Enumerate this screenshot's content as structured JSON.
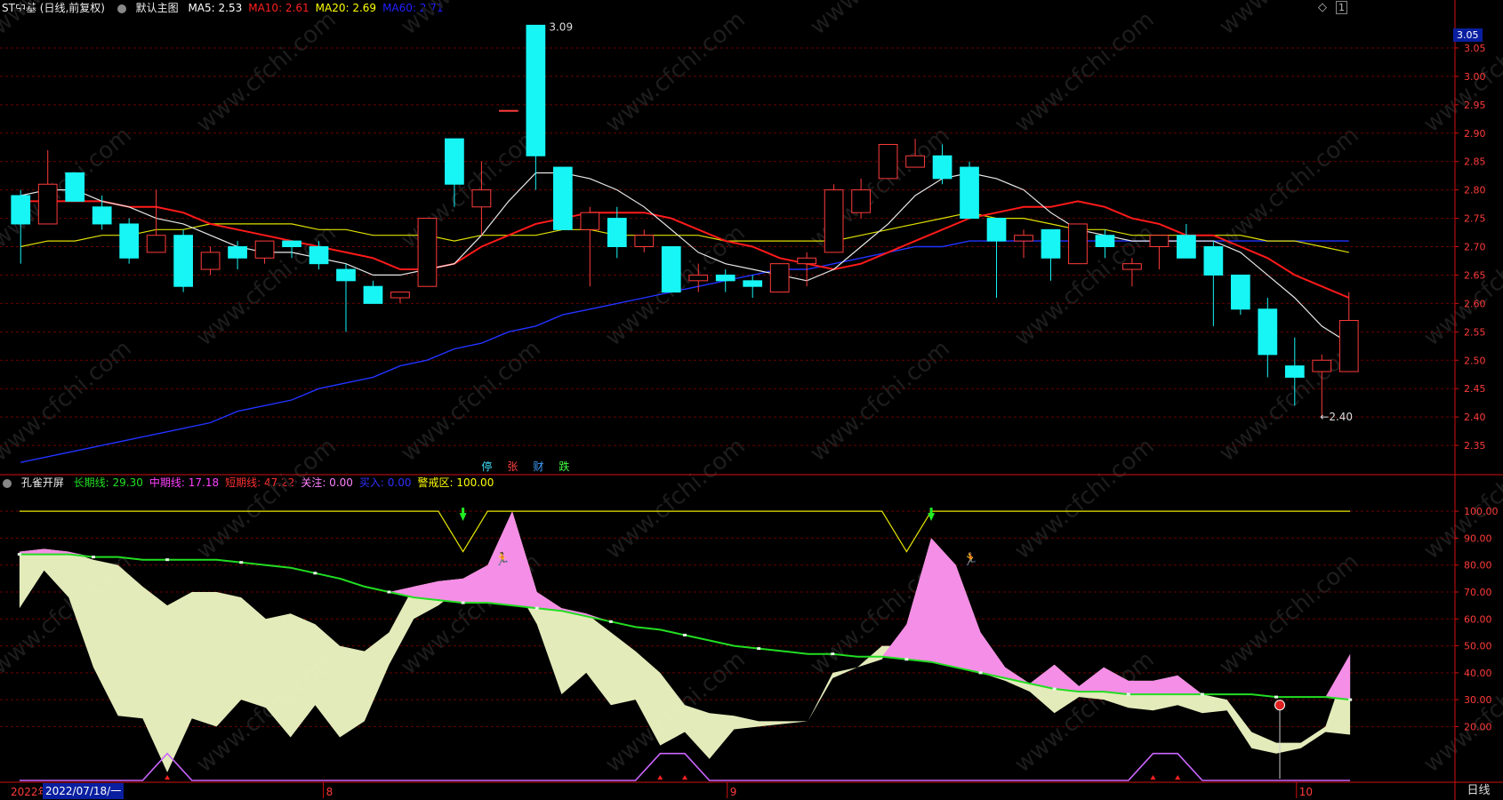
{
  "header": {
    "title": "ST中基 (日线,前复权)",
    "template_label": "默认主图",
    "ma_items": [
      {
        "name": "MA5:",
        "value": "2.53",
        "color": "#ffffff"
      },
      {
        "name": "MA10:",
        "value": "2.61",
        "color": "#ff2020"
      },
      {
        "name": "MA20:",
        "value": "2.69",
        "color": "#ffff00"
      },
      {
        "name": "MA60:",
        "value": "2.71",
        "color": "#2020ff"
      }
    ],
    "diamond_icon": "◇",
    "ctl_1": "1"
  },
  "indicator_header": {
    "name": "孔雀开屏",
    "items": [
      {
        "name": "长期线:",
        "value": "29.30",
        "color": "#22e022"
      },
      {
        "name": "中期线:",
        "value": "17.18",
        "color": "#ff40ff"
      },
      {
        "name": "短期线:",
        "value": "47.22",
        "color": "#ff3030"
      },
      {
        "name": "关注:",
        "value": "0.00",
        "color": "#ff80ff"
      },
      {
        "name": "买入:",
        "value": "0.00",
        "color": "#3030ff"
      },
      {
        "name": "警戒区:",
        "value": "100.00",
        "color": "#ffff00"
      }
    ]
  },
  "signal_labels": [
    {
      "text": "停",
      "color": "#40e0ff"
    },
    {
      "text": "张",
      "color": "#ff4040"
    },
    {
      "text": "财",
      "color": "#40a0ff"
    },
    {
      "text": "跌",
      "color": "#40ff40"
    }
  ],
  "bottom": {
    "year_label": "2022年",
    "date_label": "2022/07/18/一",
    "months": [
      "8",
      "9",
      "10"
    ],
    "period": "日线"
  },
  "price_tag": "3.05",
  "colors": {
    "up": "#ff3b3b",
    "down": "#17f5f5",
    "grid": "#6a0000",
    "axis": "#d01010",
    "watermark": "#1d1d1d"
  },
  "watermark_text": "www.cfchi.com",
  "chart_data": [
    {
      "type": "candlestick",
      "title": "ST中基 (日线,前复权)",
      "ylim": [
        2.3,
        3.1
      ],
      "y_ticks": [
        "3.05",
        "3.00",
        "2.95",
        "2.90",
        "2.85",
        "2.80",
        "2.75",
        "2.70",
        "2.65",
        "2.60",
        "2.55",
        "2.50",
        "2.45",
        "2.40",
        "2.35"
      ],
      "candles": [
        {
          "o": 2.79,
          "h": 2.8,
          "c": 2.74,
          "l": 2.67
        },
        {
          "o": 2.74,
          "h": 2.87,
          "c": 2.81,
          "l": 2.74
        },
        {
          "o": 2.83,
          "h": 2.83,
          "c": 2.78,
          "l": 2.78
        },
        {
          "o": 2.77,
          "h": 2.79,
          "c": 2.74,
          "l": 2.73
        },
        {
          "o": 2.74,
          "h": 2.75,
          "c": 2.68,
          "l": 2.67
        },
        {
          "o": 2.69,
          "h": 2.8,
          "c": 2.72,
          "l": 2.69
        },
        {
          "o": 2.72,
          "h": 2.73,
          "c": 2.63,
          "l": 2.62
        },
        {
          "o": 2.66,
          "h": 2.7,
          "c": 2.69,
          "l": 2.65
        },
        {
          "o": 2.7,
          "h": 2.71,
          "c": 2.68,
          "l": 2.66
        },
        {
          "o": 2.68,
          "h": 2.71,
          "c": 2.71,
          "l": 2.67
        },
        {
          "o": 2.71,
          "h": 2.71,
          "c": 2.7,
          "l": 2.68
        },
        {
          "o": 2.7,
          "h": 2.71,
          "c": 2.67,
          "l": 2.66
        },
        {
          "o": 2.66,
          "h": 2.67,
          "c": 2.64,
          "l": 2.55
        },
        {
          "o": 2.63,
          "h": 2.64,
          "c": 2.6,
          "l": 2.6
        },
        {
          "o": 2.61,
          "h": 2.62,
          "c": 2.62,
          "l": 2.6
        },
        {
          "o": 2.63,
          "h": 2.75,
          "c": 2.75,
          "l": 2.63
        },
        {
          "o": 2.89,
          "h": 2.89,
          "c": 2.81,
          "l": 2.77
        },
        {
          "o": 2.77,
          "h": 2.85,
          "c": 2.8,
          "l": 2.72
        },
        {
          "o": 2.94,
          "h": 2.94,
          "c": 2.94,
          "l": 2.94
        },
        {
          "o": 3.09,
          "h": 3.09,
          "c": 2.86,
          "l": 2.8
        },
        {
          "o": 2.84,
          "h": 2.84,
          "c": 2.73,
          "l": 2.73
        },
        {
          "o": 2.73,
          "h": 2.77,
          "c": 2.76,
          "l": 2.63
        },
        {
          "o": 2.75,
          "h": 2.77,
          "c": 2.7,
          "l": 2.68
        },
        {
          "o": 2.7,
          "h": 2.73,
          "c": 2.72,
          "l": 2.69
        },
        {
          "o": 2.7,
          "h": 2.7,
          "c": 2.62,
          "l": 2.62
        },
        {
          "o": 2.64,
          "h": 2.67,
          "c": 2.65,
          "l": 2.62
        },
        {
          "o": 2.65,
          "h": 2.66,
          "c": 2.64,
          "l": 2.62
        },
        {
          "o": 2.64,
          "h": 2.65,
          "c": 2.63,
          "l": 2.61
        },
        {
          "o": 2.62,
          "h": 2.67,
          "c": 2.67,
          "l": 2.62
        },
        {
          "o": 2.67,
          "h": 2.69,
          "c": 2.68,
          "l": 2.63
        },
        {
          "o": 2.69,
          "h": 2.81,
          "c": 2.8,
          "l": 2.69
        },
        {
          "o": 2.76,
          "h": 2.82,
          "c": 2.8,
          "l": 2.75
        },
        {
          "o": 2.82,
          "h": 2.87,
          "c": 2.88,
          "l": 2.82
        },
        {
          "o": 2.84,
          "h": 2.89,
          "c": 2.86,
          "l": 2.84
        },
        {
          "o": 2.86,
          "h": 2.88,
          "c": 2.82,
          "l": 2.81
        },
        {
          "o": 2.84,
          "h": 2.85,
          "c": 2.75,
          "l": 2.75
        },
        {
          "o": 2.75,
          "h": 2.75,
          "c": 2.71,
          "l": 2.61
        },
        {
          "o": 2.71,
          "h": 2.73,
          "c": 2.72,
          "l": 2.68
        },
        {
          "o": 2.73,
          "h": 2.73,
          "c": 2.68,
          "l": 2.64
        },
        {
          "o": 2.67,
          "h": 2.73,
          "c": 2.74,
          "l": 2.67
        },
        {
          "o": 2.72,
          "h": 2.73,
          "c": 2.7,
          "l": 2.68
        },
        {
          "o": 2.66,
          "h": 2.68,
          "c": 2.67,
          "l": 2.63
        },
        {
          "o": 2.7,
          "h": 2.72,
          "c": 2.72,
          "l": 2.66
        },
        {
          "o": 2.72,
          "h": 2.74,
          "c": 2.68,
          "l": 2.68
        },
        {
          "o": 2.7,
          "h": 2.71,
          "c": 2.65,
          "l": 2.56
        },
        {
          "o": 2.65,
          "h": 2.65,
          "c": 2.59,
          "l": 2.58
        },
        {
          "o": 2.59,
          "h": 2.61,
          "c": 2.51,
          "l": 2.47
        },
        {
          "o": 2.49,
          "h": 2.54,
          "c": 2.47,
          "l": 2.42
        },
        {
          "o": 2.48,
          "h": 2.51,
          "c": 2.5,
          "l": 2.4
        },
        {
          "o": 2.48,
          "h": 2.62,
          "c": 2.57,
          "l": 2.48
        }
      ],
      "ma5": [
        2.79,
        2.8,
        2.8,
        2.78,
        2.77,
        2.75,
        2.74,
        2.72,
        2.7,
        2.69,
        2.69,
        2.68,
        2.67,
        2.65,
        2.65,
        2.66,
        2.67,
        2.72,
        2.78,
        2.83,
        2.83,
        2.82,
        2.8,
        2.77,
        2.73,
        2.69,
        2.67,
        2.66,
        2.65,
        2.64,
        2.66,
        2.7,
        2.74,
        2.79,
        2.82,
        2.83,
        2.82,
        2.8,
        2.76,
        2.73,
        2.72,
        2.71,
        2.71,
        2.71,
        2.71,
        2.69,
        2.65,
        2.61,
        2.56,
        2.53
      ],
      "ma10": [
        2.78,
        2.78,
        2.78,
        2.78,
        2.77,
        2.77,
        2.76,
        2.74,
        2.73,
        2.72,
        2.71,
        2.7,
        2.69,
        2.68,
        2.66,
        2.66,
        2.67,
        2.7,
        2.72,
        2.74,
        2.75,
        2.76,
        2.76,
        2.76,
        2.75,
        2.73,
        2.71,
        2.7,
        2.68,
        2.67,
        2.66,
        2.67,
        2.69,
        2.71,
        2.73,
        2.75,
        2.76,
        2.77,
        2.77,
        2.78,
        2.77,
        2.75,
        2.74,
        2.72,
        2.72,
        2.7,
        2.68,
        2.65,
        2.63,
        2.61
      ],
      "ma20": [
        2.7,
        2.71,
        2.71,
        2.72,
        2.72,
        2.73,
        2.73,
        2.74,
        2.74,
        2.74,
        2.74,
        2.73,
        2.73,
        2.72,
        2.72,
        2.72,
        2.71,
        2.72,
        2.72,
        2.72,
        2.73,
        2.73,
        2.72,
        2.72,
        2.72,
        2.72,
        2.71,
        2.71,
        2.71,
        2.71,
        2.71,
        2.72,
        2.73,
        2.74,
        2.75,
        2.76,
        2.75,
        2.75,
        2.74,
        2.73,
        2.73,
        2.72,
        2.72,
        2.72,
        2.72,
        2.72,
        2.71,
        2.71,
        2.7,
        2.69
      ],
      "ma60": [
        2.32,
        2.33,
        2.34,
        2.35,
        2.36,
        2.37,
        2.38,
        2.39,
        2.41,
        2.42,
        2.43,
        2.45,
        2.46,
        2.47,
        2.49,
        2.5,
        2.52,
        2.53,
        2.55,
        2.56,
        2.58,
        2.59,
        2.6,
        2.61,
        2.62,
        2.63,
        2.64,
        2.65,
        2.66,
        2.66,
        2.67,
        2.68,
        2.69,
        2.7,
        2.7,
        2.71,
        2.71,
        2.71,
        2.71,
        2.71,
        2.71,
        2.71,
        2.71,
        2.71,
        2.71,
        2.71,
        2.71,
        2.71,
        2.71,
        2.71
      ],
      "annotations": {
        "high_label": "3.09",
        "low_label": "←2.40",
        "high_index": 19,
        "low_index": 48
      }
    },
    {
      "type": "area",
      "title": "孔雀开屏",
      "ylim": [
        0,
        105
      ],
      "y_ticks": [
        "100.00",
        "90.00",
        "80.00",
        "70.00",
        "60.00",
        "50.00",
        "40.00",
        "30.00",
        "20.00"
      ],
      "long_line": [
        84,
        84,
        84,
        83,
        83,
        82,
        82,
        82,
        82,
        81,
        80,
        79,
        77,
        75,
        72,
        70,
        68,
        67,
        66,
        66,
        65,
        64,
        63,
        61,
        59,
        57,
        56,
        54,
        52,
        50,
        49,
        48,
        47,
        47,
        46,
        46,
        45,
        44,
        42,
        40,
        38,
        36,
        34,
        33,
        33,
        32,
        32,
        32,
        32,
        32,
        32,
        31,
        31,
        31,
        30
      ],
      "short_line": [
        85,
        86,
        85,
        82,
        80,
        72,
        65,
        70,
        70,
        68,
        60,
        62,
        58,
        50,
        48,
        55,
        72,
        74,
        75,
        80,
        100,
        70,
        64,
        62,
        55,
        48,
        40,
        28,
        25,
        24,
        22,
        22,
        22,
        40,
        42,
        45,
        58,
        90,
        80,
        55,
        42,
        36,
        43,
        35,
        42,
        37,
        37,
        39,
        32,
        30,
        18,
        14,
        14,
        20,
        47
      ],
      "mid_line": [
        64,
        78,
        68,
        42,
        24,
        23,
        3,
        23,
        20,
        30,
        27,
        16,
        28,
        16,
        22,
        43,
        60,
        65,
        72,
        80,
        74,
        58,
        32,
        40,
        28,
        30,
        13,
        18,
        8,
        19,
        20,
        21,
        22,
        38,
        42,
        50,
        50,
        52,
        49,
        40,
        37,
        33,
        25,
        31,
        30,
        27,
        26,
        28,
        25,
        26,
        12,
        10,
        12,
        18,
        17
      ],
      "warning_zone": 100,
      "warning_line": [
        100,
        100,
        100,
        100,
        100,
        100,
        100,
        100,
        100,
        100,
        100,
        100,
        100,
        100,
        100,
        100,
        100,
        100,
        85,
        100,
        100,
        100,
        100,
        100,
        100,
        100,
        100,
        100,
        100,
        100,
        100,
        100,
        100,
        100,
        100,
        100,
        85,
        100,
        100,
        100,
        100,
        100,
        100,
        100,
        100,
        100,
        100,
        100,
        100,
        100,
        100,
        100,
        100,
        100,
        100
      ],
      "attention_line": [
        0,
        0,
        0,
        0,
        0,
        0,
        10,
        0,
        0,
        0,
        0,
        0,
        0,
        0,
        0,
        0,
        0,
        0,
        0,
        0,
        0,
        0,
        0,
        0,
        0,
        0,
        10,
        10,
        0,
        0,
        0,
        0,
        0,
        0,
        0,
        0,
        0,
        0,
        0,
        0,
        0,
        0,
        0,
        0,
        0,
        0,
        10,
        10,
        0,
        0,
        0,
        0,
        0,
        0,
        0
      ],
      "buy_signal_index": [
        18,
        37
      ],
      "sell_signal_index": [
        19,
        38
      ],
      "marker_index": 51
    }
  ]
}
